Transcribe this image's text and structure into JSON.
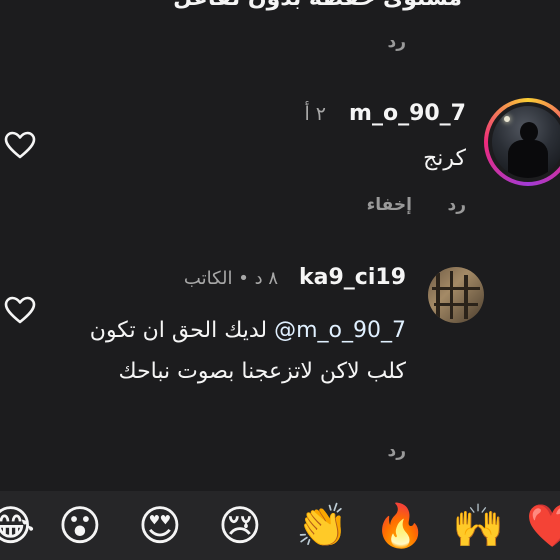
{
  "top_comment": {
    "text_cut": "مستوى حفظه بدون تفاعل",
    "reply_label": "رد"
  },
  "comment1": {
    "username": "m_o_90_7",
    "time": "٢ أ",
    "text": "كرنج",
    "reply_label": "رد",
    "hide_label": "إخفاء"
  },
  "comment2": {
    "username": "ka9_ci19",
    "time": "٨ د • الكاتب",
    "mention": "m_o_90_7@",
    "text": "لديك الحق ان تكون كلب لاكن لاتزعجنا بصوت نباحك",
    "reply_label": "رد"
  },
  "emoji_bar": {
    "emojis": [
      "😂",
      "😮",
      "😍",
      "😢",
      "👏",
      "🔥",
      "🙌",
      "❤️"
    ]
  },
  "colors": {
    "background": "#1c1c1e",
    "text": "#f5f5f5",
    "secondary": "#9a9a9a",
    "story_ring": [
      "#f9ce34",
      "#ee2a7b",
      "#a13bd6"
    ]
  }
}
